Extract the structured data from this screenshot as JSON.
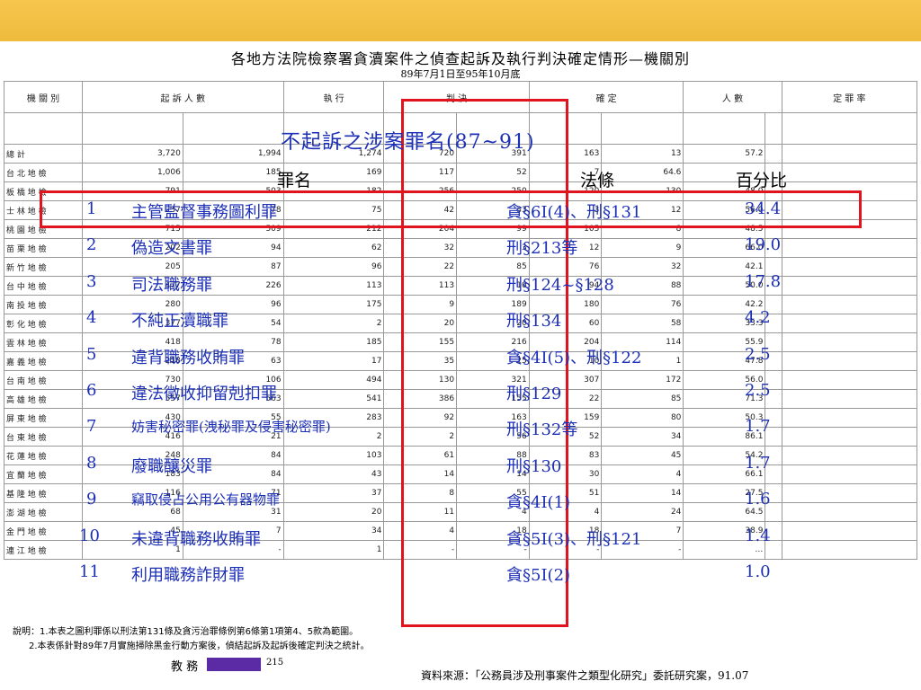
{
  "document": {
    "title": "各地方法院檢察署貪瀆案件之偵查起訴及執行判決確定情形—機關別",
    "subtitle": "89年7月1日至95年10月底",
    "notes": [
      "說明：1.本表之圖利罪係以刑法第131條及貪污治罪條例第6條第1項第4、5款為範圍。",
      "2.本表係針對89年7月實施掃除黑金行動方案後，偵結起訴及起訴後確定判決之統計。"
    ],
    "source": "資料來源：「公務員涉及刑事案件之類型化研究」委託研究案，91.07"
  },
  "header_row": [
    "機 關 別",
    "起 訴 人 數",
    "執 行",
    "判 決",
    "確 定",
    "人 數",
    "定 罪 率"
  ],
  "background_rows": [
    [
      "總 計",
      "3,720",
      "1,994",
      "1,274",
      "720",
      "391",
      "163",
      "13",
      "57.2"
    ],
    [
      "台 北 地 檢",
      "1,006",
      "185",
      "169",
      "117",
      "52",
      "7",
      "64.6",
      ""
    ],
    [
      "板 橋 地 檢",
      "791",
      "503",
      "182",
      "256",
      "250",
      "120",
      "130",
      "48.0"
    ],
    [
      "士 林 地 檢",
      "237",
      "78",
      "75",
      "42",
      "33",
      "3",
      "12",
      "56.0"
    ],
    [
      "桃 園 地 檢",
      "715",
      "509",
      "212",
      "204",
      "99",
      "105",
      "8",
      "48.5"
    ],
    [
      "苗 栗 地 檢",
      "202",
      "94",
      "62",
      "32",
      "3",
      "12",
      "9",
      "66.0"
    ],
    [
      "新 竹 地 檢",
      "205",
      "87",
      "96",
      "22",
      "85",
      "76",
      "32",
      "42.1"
    ],
    [
      "台 中 地 檢",
      "477",
      "226",
      "113",
      "113",
      "10",
      "94",
      "88",
      "50.0"
    ],
    [
      "南 投 地 檢",
      "280",
      "96",
      "175",
      "9",
      "189",
      "180",
      "76",
      "42.2"
    ],
    [
      "彰 化 地 檢",
      "377",
      "54",
      "2",
      "20",
      "20",
      "60",
      "58",
      "33.3"
    ],
    [
      "雲 林 地 檢",
      "418",
      "78",
      "185",
      "155",
      "216",
      "204",
      "114",
      "55.9"
    ],
    [
      "嘉 義 地 檢",
      "218",
      "63",
      "17",
      "35",
      "25",
      "10",
      "1",
      "47.8"
    ],
    [
      "台 南 地 檢",
      "730",
      "106",
      "494",
      "130",
      "321",
      "307",
      "172",
      "56.0"
    ],
    [
      "高 雄 地 檢",
      "557",
      "563",
      "541",
      "386",
      "155",
      "22",
      "85",
      "71.3"
    ],
    [
      "屏 東 地 檢",
      "430",
      "55",
      "283",
      "92",
      "163",
      "159",
      "80",
      "50.3"
    ],
    [
      "台 東 地 檢",
      "416",
      "21",
      "2",
      "2",
      "56",
      "52",
      "34",
      "86.1"
    ],
    [
      "花 蓮 地 檢",
      "248",
      "84",
      "103",
      "61",
      "88",
      "83",
      "45",
      "54.2"
    ],
    [
      "宜 蘭 地 檢",
      "183",
      "84",
      "43",
      "14",
      "14",
      "30",
      "4",
      "66.1"
    ],
    [
      "基 隆 地 檢",
      "116",
      "71",
      "37",
      "8",
      "55",
      "51",
      "14",
      "27.5"
    ],
    [
      "澎 湖 地 檢",
      "68",
      "31",
      "20",
      "11",
      "4",
      "4",
      "24",
      "64.5"
    ],
    [
      "金 門 地 檢",
      "45",
      "7",
      "34",
      "4",
      "18",
      "18",
      "7",
      "38.9"
    ],
    [
      "連 江 地 檢",
      "1",
      "-",
      "1",
      "-",
      "-",
      "-",
      "-",
      "…"
    ]
  ],
  "overlay": {
    "title": "不起訴之涉案罪名(87~91)",
    "headers": {
      "name": "罪名",
      "law": "法條",
      "pct": "百分比"
    },
    "rows": [
      {
        "no": "1",
        "name": "主管監督事務圖利罪",
        "law": "貪§6I(4)、刑§131",
        "pct": "34.4"
      },
      {
        "no": "2",
        "name": "偽造文書罪",
        "law": "刑§213等",
        "pct": "19.0"
      },
      {
        "no": "3",
        "name": "司法職務罪",
        "law": "刑§124~§128",
        "pct": "17.8"
      },
      {
        "no": "4",
        "name": "不純正瀆職罪",
        "law": "刑§134",
        "pct": "4.2"
      },
      {
        "no": "5",
        "name": "違背職務收賄罪",
        "law": "貪§4I(5)、刑§122",
        "pct": "2.5"
      },
      {
        "no": "6",
        "name": "違法徵收抑留剋扣罪",
        "law": "刑§129",
        "pct": "2.5"
      },
      {
        "no": "7",
        "name": "妨害秘密罪(洩秘罪及侵害秘密罪)",
        "law": "刑§132等",
        "pct": "1.7"
      },
      {
        "no": "8",
        "name": "廢職釀災罪",
        "law": "刑§130",
        "pct": "1.7"
      },
      {
        "no": "9",
        "name": "竊取侵占公用公有器物罪",
        "law": "貪§4I(1)",
        "pct": "1.6"
      },
      {
        "no": "10",
        "name": "未違背職務收賄罪",
        "law": "貪§5I(3)、刑§121",
        "pct": "1.4"
      },
      {
        "no": "11",
        "name": "利用職務詐財罪",
        "law": "貪§5I(2)",
        "pct": "1.0"
      }
    ]
  },
  "footer_fragment": {
    "label": "教 務",
    "value": "215"
  },
  "colors": {
    "highlight_border": "#e0141e",
    "overlay_text": "#1c2fb7",
    "top_bar": "#f2c247",
    "footer_bar": "#5b2ba6"
  }
}
